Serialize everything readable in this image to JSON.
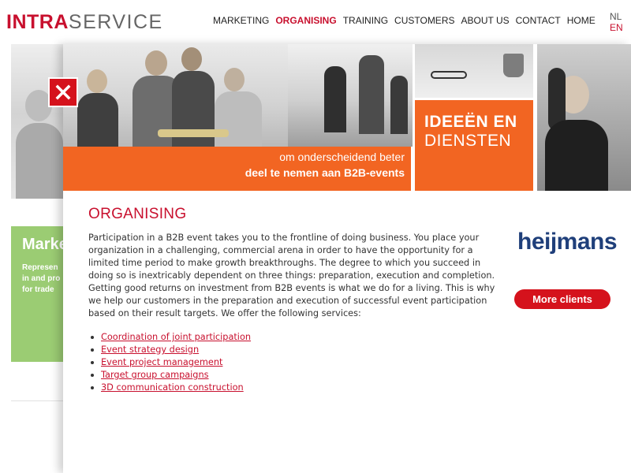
{
  "header": {
    "logo_bold": "INTRA",
    "logo_light": "SERVICE",
    "nav": [
      {
        "label": "MARKETING"
      },
      {
        "label": "ORGANISING"
      },
      {
        "label": "TRAINING"
      },
      {
        "label": "CUSTOMERS"
      },
      {
        "label": "ABOUT US"
      },
      {
        "label": "CONTACT"
      },
      {
        "label": "HOME"
      }
    ],
    "active_nav": "ORGANISING",
    "languages": [
      "NL",
      "EN"
    ],
    "active_language": "EN"
  },
  "background_page": {
    "panel_title": "Marke",
    "panel_text": "Represen\nin and pro\nfor trade",
    "panel_color": "#9bcc73"
  },
  "banner": {
    "line1": "om onderscheidend beter",
    "line2": "deel te nemen aan B2B-events",
    "box_title": "IDEEËN EN",
    "box_subtitle": "DIENSTEN",
    "accent_color": "#f26522"
  },
  "content": {
    "title": "ORGANISING",
    "paragraph": "Participation in a B2B event takes you to the frontline of doing business. You place your organization in a challenging, commercial arena in order to have the opportunity for a limited time period to make growth breakthroughs. The degree to which you succeed in doing so is inextricably dependent on three things: preparation, execution and completion. Getting good returns on investment from B2B events is what we do for a living. This is why we help our customers in the preparation and execution of successful event participation based on their result targets. We offer the following services:",
    "services": [
      "Coordination of joint participation",
      "Event strategy design",
      "Event project management",
      "Target group campaigns",
      "3D communication construction"
    ]
  },
  "sidebar": {
    "client_logo": "heijmans",
    "more_button": "More clients"
  },
  "icons": {
    "close": "close-icon"
  },
  "colors": {
    "brand_red": "#c8102e",
    "button_red": "#d5121c",
    "logo_blue": "#1f3f7a"
  }
}
